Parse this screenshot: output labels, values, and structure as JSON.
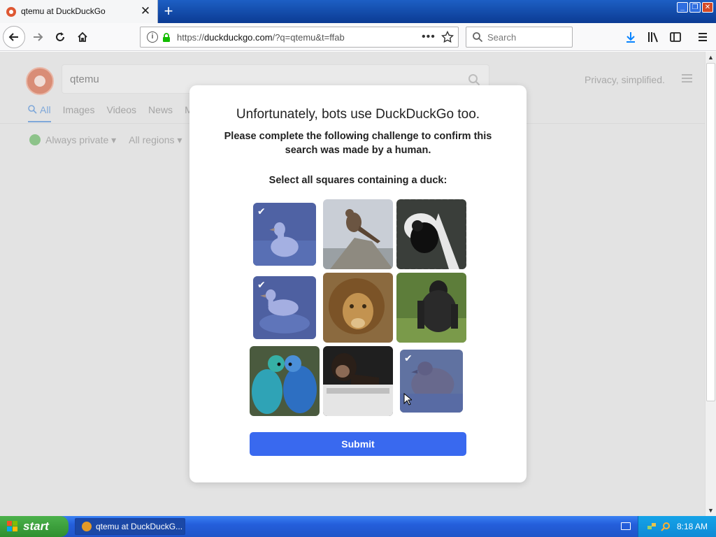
{
  "browser": {
    "tab_title": "qtemu at DuckDuckGo",
    "url_prefix": "https://",
    "url_host": "duckduckgo.com",
    "url_rest": "/?q=qtemu&t=ffab",
    "search_placeholder": "Search"
  },
  "page": {
    "query": "qtemu",
    "privacy_text": "Privacy, simplified.",
    "tabs": [
      "All",
      "Images",
      "Videos",
      "News",
      "M"
    ],
    "filters": [
      "Always private ▾",
      "All regions ▾"
    ]
  },
  "modal": {
    "title": "Unfortunately, bots use DuckDuckGo too.",
    "subtitle": "Please complete the following challenge to confirm this search was made by a human.",
    "prompt": "Select all squares containing a duck:",
    "submit_label": "Submit",
    "tiles": [
      {
        "subject": "white duck",
        "selected": true
      },
      {
        "subject": "bird on rock",
        "selected": false
      },
      {
        "subject": "colobus monkey",
        "selected": false
      },
      {
        "subject": "white duck",
        "selected": true
      },
      {
        "subject": "lion",
        "selected": false
      },
      {
        "subject": "gorilla",
        "selected": false
      },
      {
        "subject": "parakeets",
        "selected": false
      },
      {
        "subject": "chimpanzee",
        "selected": false
      },
      {
        "subject": "duck",
        "selected": true
      }
    ]
  },
  "taskbar": {
    "start_label": "start",
    "task_label": "qtemu at DuckDuckG...",
    "clock": "8:18 AM"
  },
  "colors": {
    "submit": "#3969ef",
    "selected_overlay": "#3a50c8",
    "taskbar": "#245edb",
    "start": "#3c9f3c"
  }
}
